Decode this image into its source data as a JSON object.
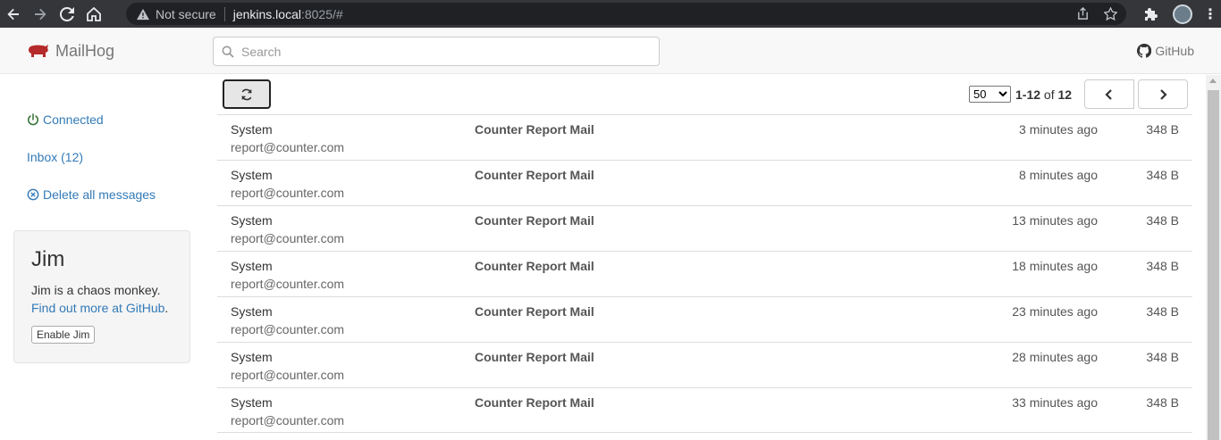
{
  "browser": {
    "security_label": "Not secure",
    "url_host": "jenkins.local",
    "url_rest": ":8025/#"
  },
  "navbar": {
    "brand": "MailHog",
    "search_placeholder": "Search",
    "github_label": "GitHub"
  },
  "sidebar": {
    "connected_label": "Connected",
    "inbox_label": "Inbox (12)",
    "delete_label": "Delete all messages"
  },
  "jim": {
    "title": "Jim",
    "description": "Jim is a chaos monkey.",
    "link_text": "Find out more at GitHub",
    "link_suffix": ".",
    "button_label": "Enable Jim"
  },
  "toolbar": {
    "page_size_options": [
      "50"
    ],
    "page_size_selected": "50",
    "range": "1-12",
    "of_label": "of",
    "total": "12"
  },
  "messages": [
    {
      "from_name": "System",
      "from_email": "report@counter.com",
      "subject": "Counter Report Mail",
      "time": "3 minutes ago",
      "size": "348 B"
    },
    {
      "from_name": "System",
      "from_email": "report@counter.com",
      "subject": "Counter Report Mail",
      "time": "8 minutes ago",
      "size": "348 B"
    },
    {
      "from_name": "System",
      "from_email": "report@counter.com",
      "subject": "Counter Report Mail",
      "time": "13 minutes ago",
      "size": "348 B"
    },
    {
      "from_name": "System",
      "from_email": "report@counter.com",
      "subject": "Counter Report Mail",
      "time": "18 minutes ago",
      "size": "348 B"
    },
    {
      "from_name": "System",
      "from_email": "report@counter.com",
      "subject": "Counter Report Mail",
      "time": "23 minutes ago",
      "size": "348 B"
    },
    {
      "from_name": "System",
      "from_email": "report@counter.com",
      "subject": "Counter Report Mail",
      "time": "28 minutes ago",
      "size": "348 B"
    },
    {
      "from_name": "System",
      "from_email": "report@counter.com",
      "subject": "Counter Report Mail",
      "time": "33 minutes ago",
      "size": "348 B"
    }
  ],
  "colors": {
    "link": "#337ab7",
    "connected": "#3c763d",
    "brand_logo": "#b52a2a"
  }
}
